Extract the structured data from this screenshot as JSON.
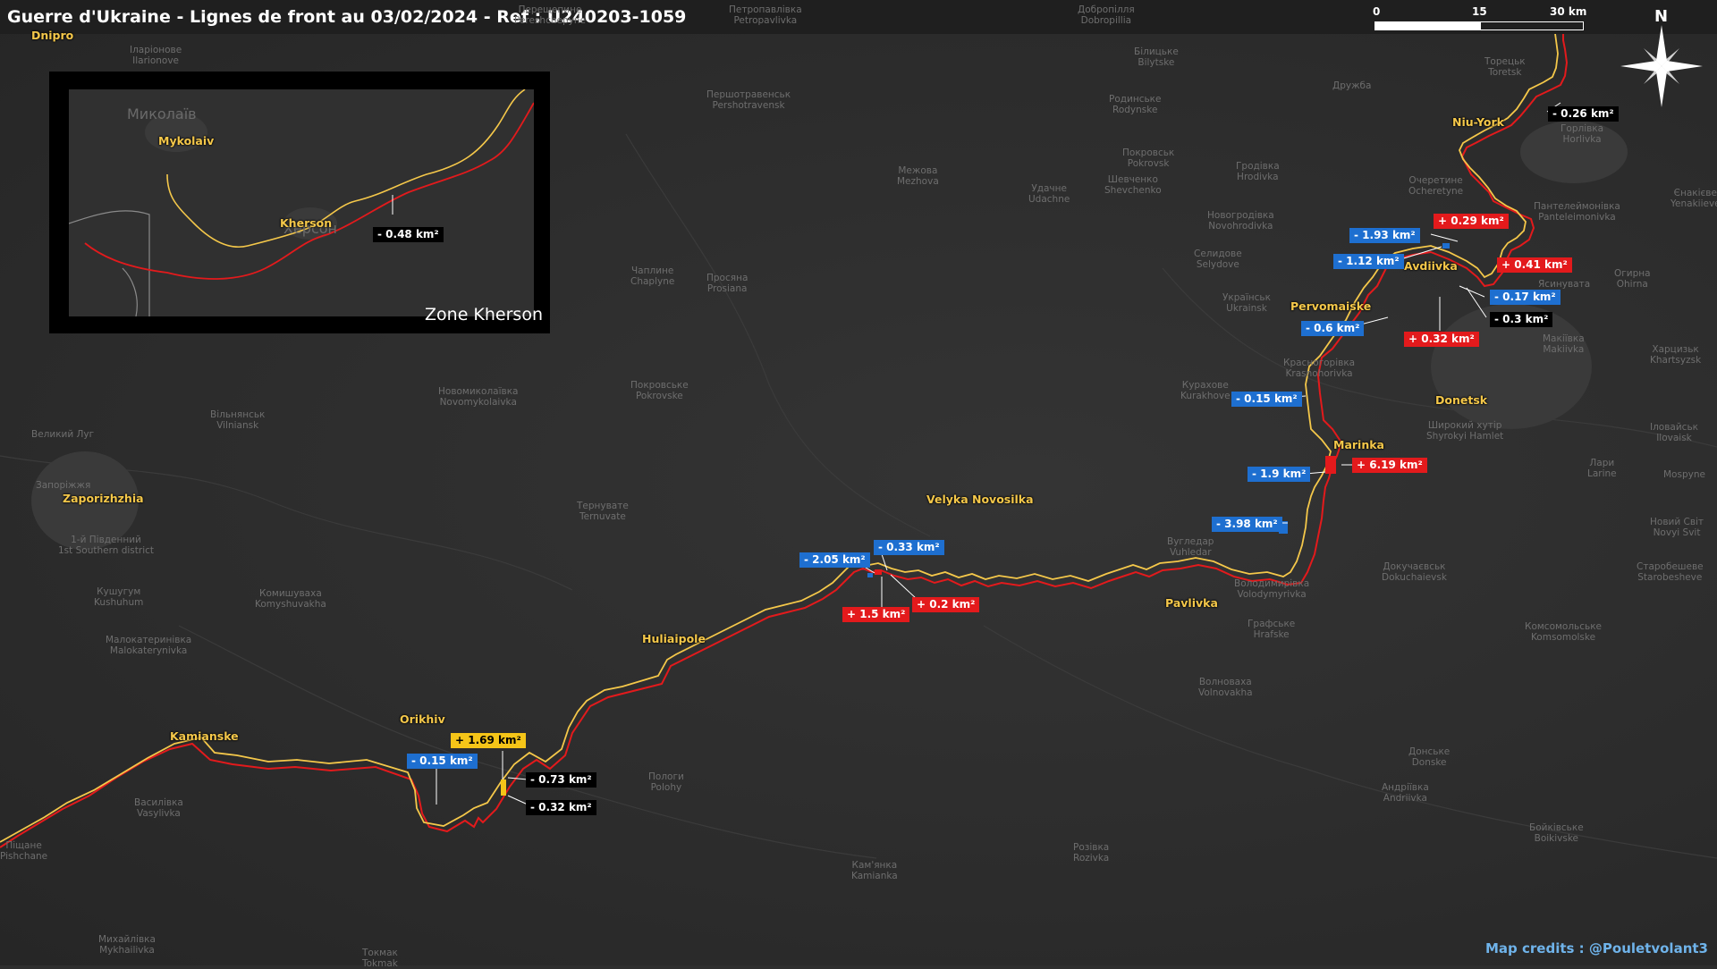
{
  "title": "Guerre d'Ukraine - Lignes de front au 03/02/2024 - Ref : U240203-1059",
  "scale": {
    "labels": [
      "0",
      "15",
      "30 km"
    ]
  },
  "north_label": "N",
  "credits": "Map credits : @Pouletvolant3",
  "inset": {
    "zone_label": "Zone Kherson",
    "cities": [
      "Mykolaiv",
      "Kherson"
    ],
    "places": [
      "Миколаїв",
      "Херсон"
    ],
    "change": "- 0.48 km²"
  },
  "cities": [
    "Dnipro",
    "Zaporizhzhia",
    "Kamianske",
    "Orikhiv",
    "Huliaipole",
    "Velyka Novosilka",
    "Pavlivka",
    "Marinka",
    "Donetsk",
    "Pervomaiske",
    "Avdiivka",
    "Niu-York"
  ],
  "places": [
    "Іларіонове\nIlarionove",
    "Перещепине\nPereshchepyne",
    "Першотравенськ\nPershotravensk",
    "Покровське\nPokrovske",
    "Новомиколаївка\nNovomykolaivka",
    "Вільнянськ\nVilniansk",
    "Великий Луг",
    "Запоріжжя",
    "1-й Південний\n1st Southern district",
    "Кушугум\nKushuhum",
    "Комишуваха\nKomyshuvakha",
    "Малокатеринівка\nMalokaterynivka",
    "Тернувате\nTernuvate",
    "Чаплине\nChaplyne",
    "Просяна\nProsiana",
    "Межова\nMezhova",
    "Удачне\nUdachne",
    "Шевченко\nShevchenko",
    "Покровськ\nPokrovsk",
    "Гродівка\nHrodivka",
    "Новогродівка\nNovohrodivka",
    "Селидове\nSelydove",
    "Українськ\nUkrainsk",
    "Курахове\nKurakhove",
    "Красногорівка\nKrasnohorivka",
    "Очеретине\nOcheretyne",
    "Торецьк\nToretsk",
    "Горлівка\nHorlivka",
    "Єнакієве\nYenakiieve",
    "Пантелеймонівка\nPanteleimonivka",
    "Ясинувата",
    "Макіївка\nMakiivka",
    "Харцизьк\nKhartsyzsk",
    "Широкий хутір\nShyrokyi Hamlet",
    "Іловайськ\nIlovaisk",
    "Мospyne",
    "Новий Світ\nNovyi Svit",
    "Старобешеве\nStarobesheve",
    "Комсомольське\nKomsomolske",
    "Докучаєвськ\nDokuchaievsk",
    "Волноваха\nVolnovakha",
    "Донське\nDonske",
    "Андріївка\nAndriivka",
    "Бойківське\nBoikivske",
    "Графське\nHrafske",
    "Вугледар\nVuhledar",
    "Володимирівка\nVolodymyrivka",
    "Пологи\nPolohy",
    "Кам'янка\nKamianka",
    "Розівка\nRozivka",
    "Михайлівка\nMykhailivka",
    "Василівка\nVasylivka",
    "Токмак\nTokmak",
    "Піщане\nPishchane",
    "Білицьке\nBilytske",
    "Родинське\nRodynske",
    "Дружба",
    "Огирна\nOhirna",
    "Петропавлівка\nPetropavlivka",
    "Добропілля\nDobropillia",
    "Лари\nLarine"
  ],
  "changes": [
    {
      "text": "- 0.26 km²",
      "color": "black"
    },
    {
      "text": "+ 0.29 km²",
      "color": "red"
    },
    {
      "text": "- 1.93 km²",
      "color": "blue"
    },
    {
      "text": "- 1.12 km²",
      "color": "blue"
    },
    {
      "text": "+ 0.41 km²",
      "color": "red"
    },
    {
      "text": "- 0.17 km²",
      "color": "blue"
    },
    {
      "text": "- 0.3 km²",
      "color": "black"
    },
    {
      "text": "- 0.6 km²",
      "color": "blue"
    },
    {
      "text": "+ 0.32 km²",
      "color": "red"
    },
    {
      "text": "- 0.15 km²",
      "color": "blue"
    },
    {
      "text": "- 1.9 km²",
      "color": "blue"
    },
    {
      "text": "+ 6.19 km²",
      "color": "red"
    },
    {
      "text": "- 3.98 km²",
      "color": "blue"
    },
    {
      "text": "- 0.33 km²",
      "color": "blue"
    },
    {
      "text": "- 2.05 km²",
      "color": "blue"
    },
    {
      "text": "+ 1.5 km²",
      "color": "red"
    },
    {
      "text": "+ 0.2 km²",
      "color": "red"
    },
    {
      "text": "+ 1.69 km²",
      "color": "yellow"
    },
    {
      "text": "- 0.15 km²",
      "color": "blue"
    },
    {
      "text": "- 0.73 km²",
      "color": "black"
    },
    {
      "text": "- 0.32 km²",
      "color": "black"
    }
  ],
  "colors": {
    "front_red": "#e31a1c",
    "front_yellow": "#f5c84a",
    "gain_blue": "#1e6fd0",
    "credits": "#6fb3ea"
  }
}
